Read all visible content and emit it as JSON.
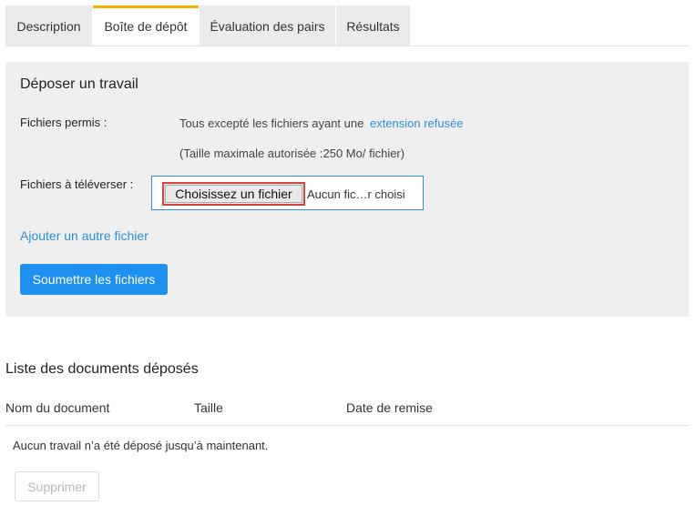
{
  "tabs": [
    {
      "label": "Description",
      "active": false
    },
    {
      "label": "Boîte de dépôt",
      "active": true
    },
    {
      "label": "Évaluation des pairs",
      "active": false
    },
    {
      "label": "Résultats",
      "active": false
    }
  ],
  "upload": {
    "title": "Déposer un travail",
    "allowed_label": "Fichiers permis :",
    "allowed_text": "Tous excepté les fichiers ayant une",
    "allowed_link": "extension refusée",
    "size_note": "(Taille maximale autorisée :250 Mo/ fichier)",
    "files_label": "Fichiers à téléverser :",
    "choose_button": "Choisissez un fichier",
    "no_file_text": "Aucun fic…r choisi",
    "add_file_link": "Ajouter un autre fichier",
    "submit_button": "Soumettre les fichiers"
  },
  "documents": {
    "title": "Liste des documents déposés",
    "columns": [
      "Nom du document",
      "Taille",
      "Date de remise"
    ],
    "empty_message": "Aucun travail n’a été déposé jusqu’à maintenant.",
    "delete_button": "Supprimer",
    "delete_disabled": true
  },
  "colors": {
    "accent": "#2a8fde",
    "active_tab_border": "#f2b600",
    "submit_bg": "#1e90f0",
    "highlight": "#d9443a"
  }
}
